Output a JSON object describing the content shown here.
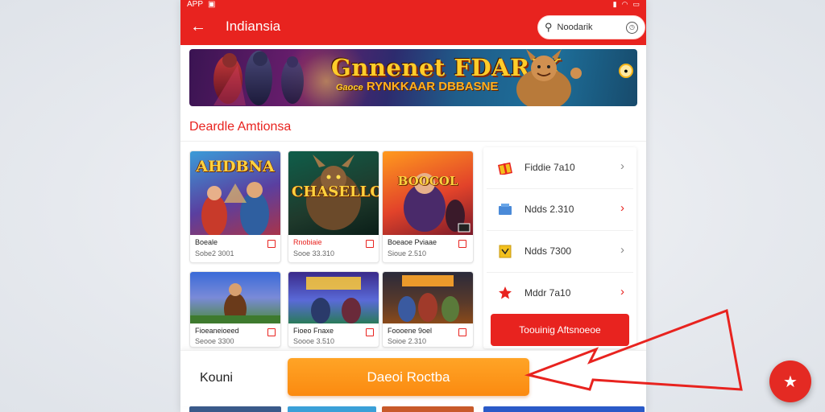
{
  "status_bar": {
    "app_label": "APP"
  },
  "header": {
    "title": "Indiansia",
    "search": {
      "value": "Noodarik"
    }
  },
  "banner": {
    "title": "Gnnenet FDARIK",
    "subtitle_prefix": "Gaoce",
    "subtitle_main": "RYNKKAAR DBBASNE"
  },
  "section": {
    "title": "Deardle Amtionsa"
  },
  "games": [
    {
      "thumb_text": "AHDBNA",
      "name": "Boeale",
      "price": "Sobe2 3001",
      "name_color": "#222222"
    },
    {
      "thumb_text": "CHASELLO",
      "name": "Rnobiaie",
      "price": "Sooe 33.310",
      "name_color": "#e8231f"
    },
    {
      "thumb_text": "BOOCOL",
      "name": "Boeaoe Pviaae",
      "price": "Sioue 2.510",
      "name_color": "#222222"
    },
    {
      "thumb_text": "",
      "name": "Fioeaneioeed",
      "price": "Seooe 3300",
      "name_color": "#222222"
    },
    {
      "thumb_text": "",
      "name": "Fioeo Fnaxe",
      "price": "Soooe 3.510",
      "name_color": "#222222"
    },
    {
      "thumb_text": "",
      "name": "Foooene 9oel",
      "price": "Soioe 2.310",
      "name_color": "#222222"
    }
  ],
  "side_panel": {
    "items": [
      {
        "label": "Fiddie 7a10",
        "icon": "gift-box-icon",
        "chevron_color": "#888888"
      },
      {
        "label": "Ndds 2.310",
        "icon": "cart-icon",
        "chevron_color": "#e8231f"
      },
      {
        "label": "Ndds 7300",
        "icon": "ticket-icon",
        "chevron_color": "#888888"
      },
      {
        "label": "Mddr 7a10",
        "icon": "star-icon",
        "chevron_color": "#e8231f"
      }
    ],
    "button_label": "Toouinig Aftsnoeoe"
  },
  "bottom": {
    "label": "Kouni",
    "cta_label": "Daeoi Roctba"
  },
  "colors": {
    "primary_red": "#e8231f",
    "cta_orange": "#fb8a10"
  }
}
